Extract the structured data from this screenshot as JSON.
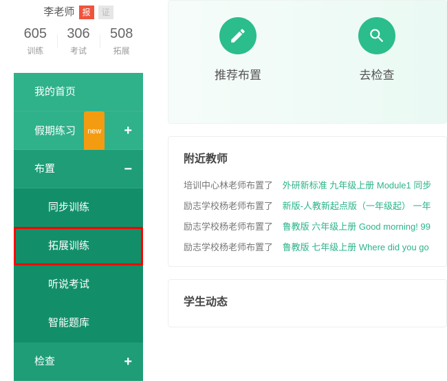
{
  "teacher": {
    "name": "李老师",
    "tag_bao": "报",
    "tag_zheng": "证"
  },
  "stats": [
    {
      "num": "605",
      "label": "训练"
    },
    {
      "num": "306",
      "label": "考试"
    },
    {
      "num": "508",
      "label": "拓展"
    }
  ],
  "nav": {
    "home": "我的首页",
    "vacation": "假期练习",
    "vacation_new": "new",
    "assign": "布置",
    "sub": {
      "sync": "同步训练",
      "expand": "拓展训练",
      "listen": "听说考试",
      "bank": "智能题库"
    },
    "check": "检查"
  },
  "hero": {
    "recommend": "推荐布置",
    "gocheck": "去检查"
  },
  "nearby": {
    "title": "附近教师",
    "rows": [
      {
        "who": "培训中心林老师布置了",
        "work": "外研新标准 九年级上册 Module1 同步"
      },
      {
        "who": "励志学校杨老师布置了",
        "work": "新版-人教新起点版（一年级起） 一年"
      },
      {
        "who": "励志学校杨老师布置了",
        "work": "鲁教版 六年级上册 Good morning! 99"
      },
      {
        "who": "励志学校杨老师布置了",
        "work": "鲁教版 七年级上册 Where did you go"
      }
    ]
  },
  "student": {
    "title": "学生动态"
  }
}
